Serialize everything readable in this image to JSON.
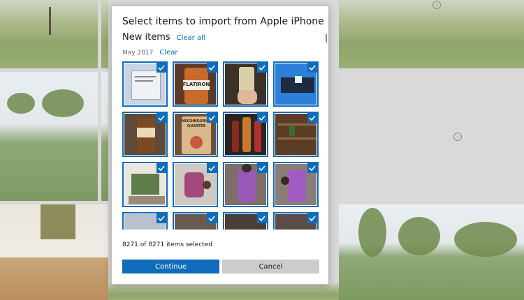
{
  "dialog": {
    "title": "Select items to import from Apple iPhone",
    "subtitle": "New items",
    "clear_all_label": "Clear all",
    "group": {
      "date": "May 2017",
      "clear_label": "Clear"
    },
    "status_text": "8271 of 8271 items selected",
    "continue_label": "Continue",
    "cancel_label": "Cancel"
  },
  "thumbnails": [
    {
      "photo": "screenshot of dialog",
      "selected": true
    },
    {
      "photo": "Flatiron beer bottle",
      "selected": true,
      "label": "FLATIRON"
    },
    {
      "photo": "beer bottle held in hand",
      "selected": true
    },
    {
      "photo": "blue screen photo",
      "selected": true
    },
    {
      "photo": "beer bottle on shelf",
      "selected": true
    },
    {
      "photo": "Neighbourhood Quarter tin",
      "selected": true,
      "label": "NEIGHBOURHOOD QUARTER"
    },
    {
      "photo": "bottles on table",
      "selected": true
    },
    {
      "photo": "wooden shelves",
      "selected": true
    },
    {
      "photo": "shop front",
      "selected": true
    },
    {
      "photo": "person sitting (rotated)",
      "selected": true
    },
    {
      "photo": "person in purple (rotated)",
      "selected": true
    },
    {
      "photo": "person in purple (rotated)",
      "selected": true
    },
    {
      "photo": "partial row",
      "selected": true
    },
    {
      "photo": "partial row",
      "selected": true
    },
    {
      "photo": "partial row",
      "selected": true
    },
    {
      "photo": "partial row",
      "selected": true
    }
  ],
  "colors": {
    "accent": "#0f6cbd",
    "link": "#0067c0",
    "button_secondary": "#cccccc"
  },
  "icons": {
    "check": "checkmark-icon"
  }
}
